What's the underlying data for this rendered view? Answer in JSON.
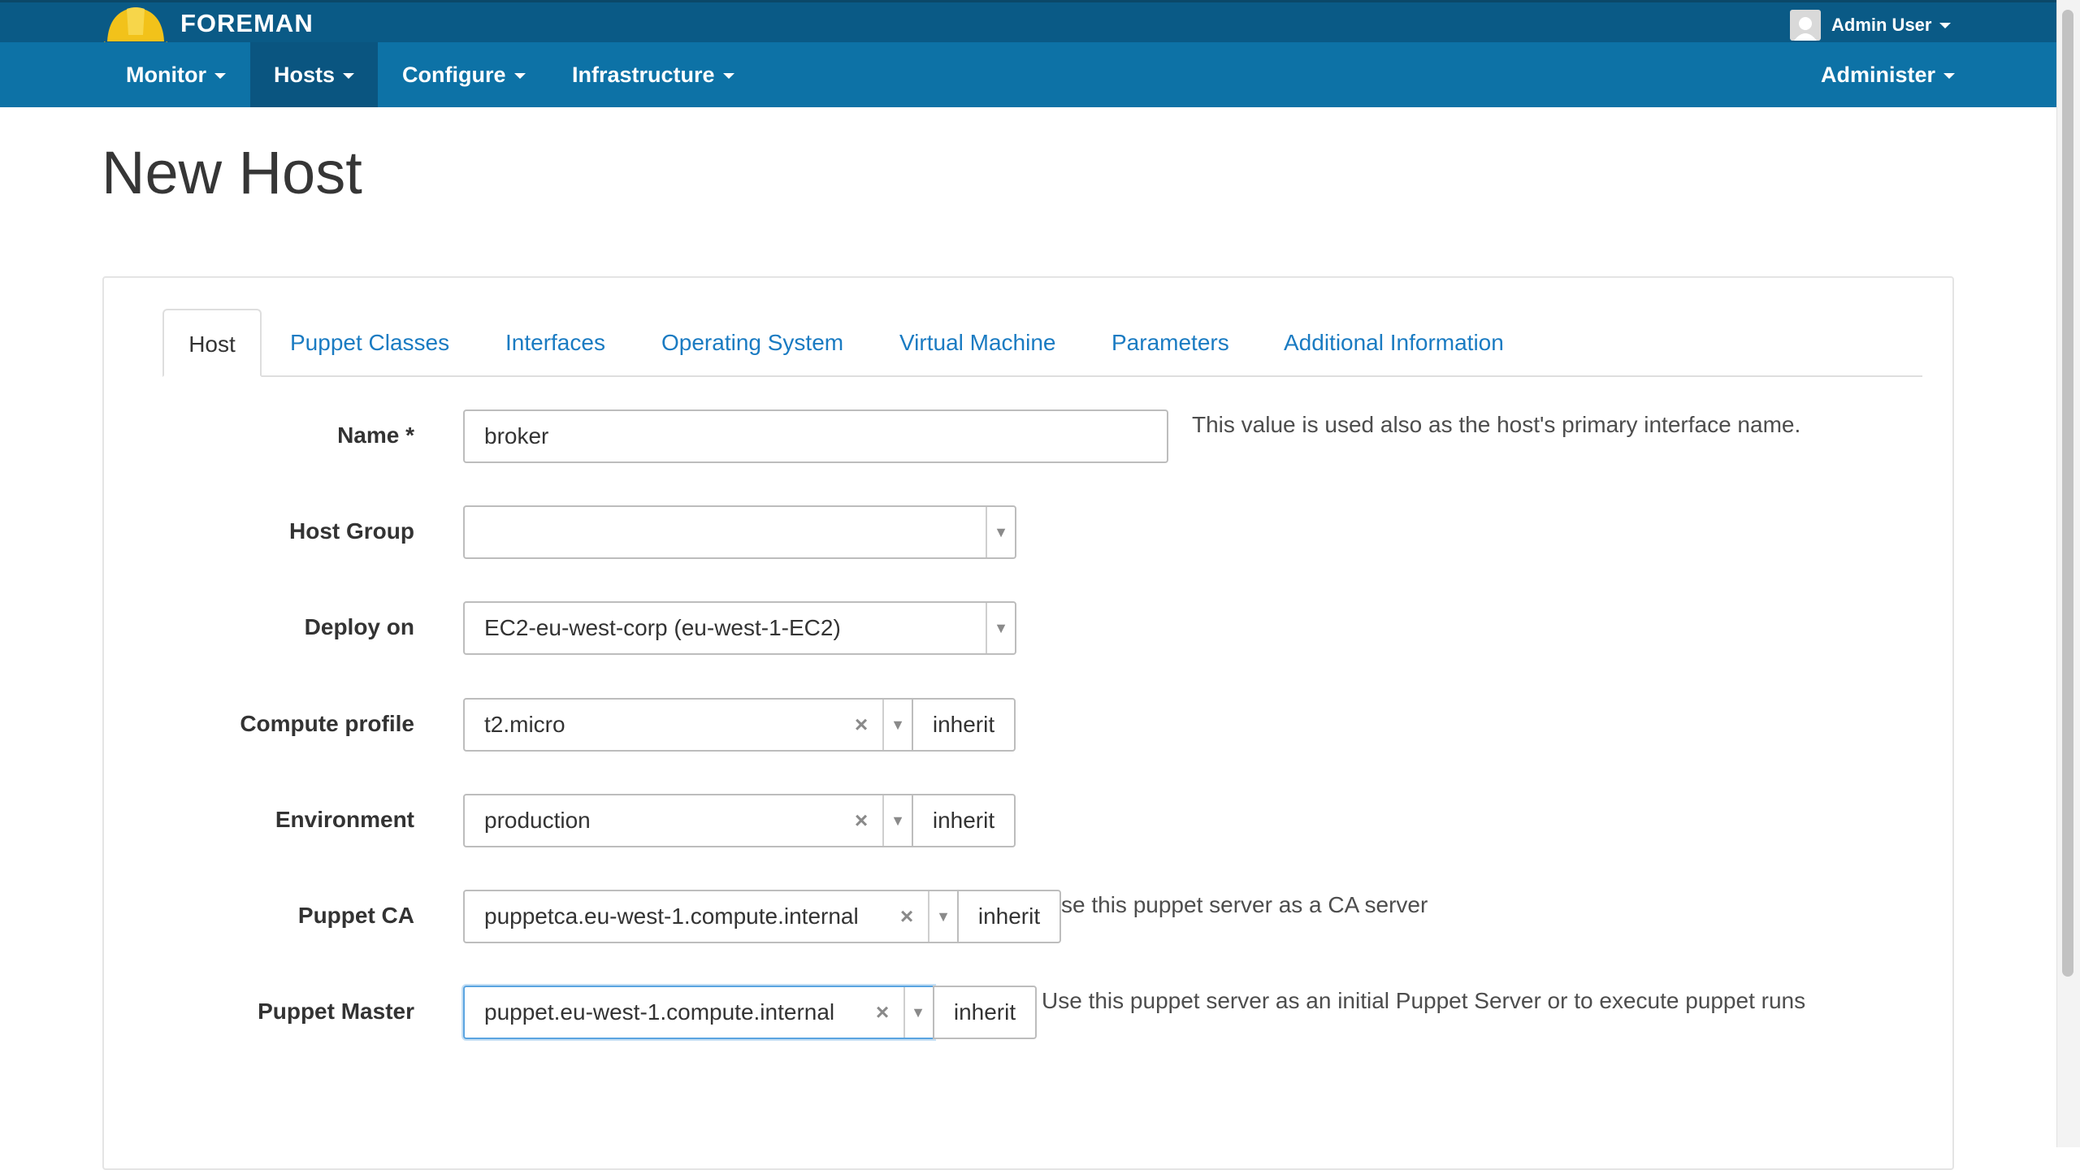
{
  "app": {
    "brand": "FOREMAN",
    "user": "Admin User"
  },
  "nav": {
    "items": [
      "Monitor",
      "Hosts",
      "Configure",
      "Infrastructure"
    ],
    "right": "Administer"
  },
  "page": {
    "title": "New Host"
  },
  "tabs": [
    "Host",
    "Puppet Classes",
    "Interfaces",
    "Operating System",
    "Virtual Machine",
    "Parameters",
    "Additional Information"
  ],
  "form": {
    "name": {
      "label": "Name *",
      "value": "broker",
      "help": "This value is used also as the host's primary interface name."
    },
    "host_group": {
      "label": "Host Group",
      "value": ""
    },
    "deploy_on": {
      "label": "Deploy on",
      "value": "EC2-eu-west-corp (eu-west-1-EC2)"
    },
    "compute_profile": {
      "label": "Compute profile",
      "value": "t2.micro",
      "button": "inherit"
    },
    "environment": {
      "label": "Environment",
      "value": "production",
      "button": "inherit"
    },
    "puppet_ca": {
      "label": "Puppet CA",
      "value": "puppetca.eu-west-1.compute.internal",
      "button": "inherit",
      "help": "se this puppet server as a CA server"
    },
    "puppet_master": {
      "label": "Puppet Master",
      "value": "puppet.eu-west-1.compute.internal",
      "button": "inherit",
      "help": "Use this puppet server as an initial Puppet Server or to execute puppet runs"
    }
  },
  "glyphs": {
    "clear": "×",
    "arrow": "▼"
  },
  "colors": {
    "header": "#0a5a86",
    "nav": "#0d72a6",
    "nav_active": "#0a5580",
    "link": "#1a7bc2",
    "focus": "#5aa4e0"
  }
}
